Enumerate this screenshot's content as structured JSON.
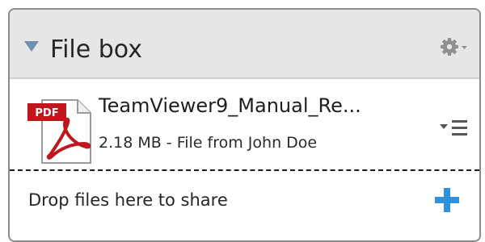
{
  "file_box": {
    "title": "File box",
    "header_icons": {
      "collapse": "collapse-triangle-icon",
      "settings": "gear-dropdown-icon"
    },
    "files": [
      {
        "name": "TeamViewer9_Manual_Re...",
        "meta": "2.18 MB - File from John Doe",
        "type_badge": "PDF",
        "icon": "pdf-file-icon",
        "menu_icon": "list-menu-icon"
      }
    ],
    "drop_zone": {
      "text": "Drop files here to share",
      "add_icon": "plus-icon"
    }
  },
  "colors": {
    "header_bg": "#e6e6e6",
    "accent_blue": "#2f8fe0",
    "triangle_blue": "#6f8fb1",
    "pdf_red": "#c0171d",
    "border": "#8c8c8c"
  }
}
